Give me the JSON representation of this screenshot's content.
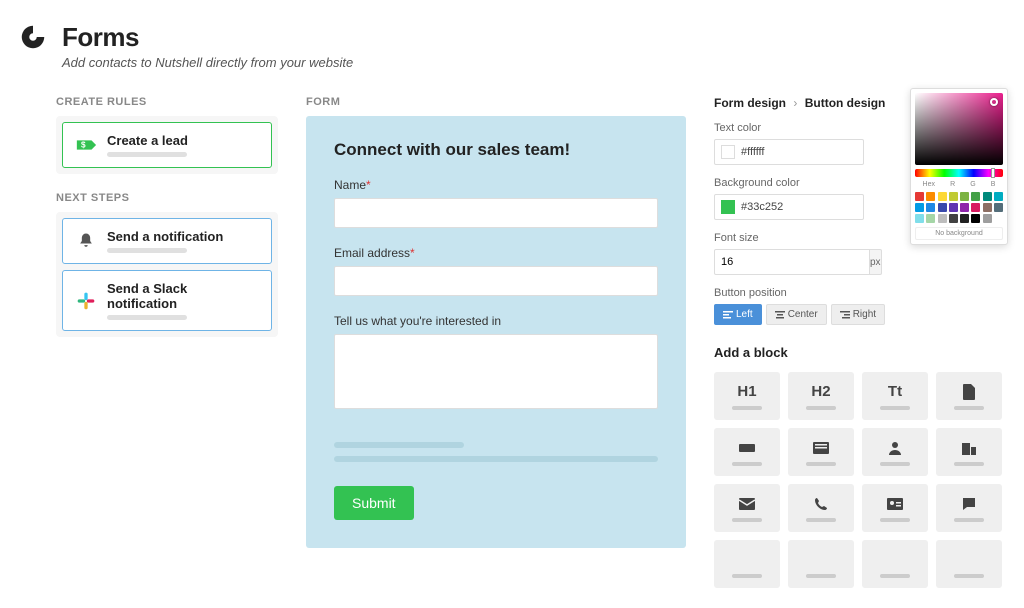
{
  "header": {
    "title": "Forms",
    "subtitle": "Add contacts to Nutshell directly from your website"
  },
  "left": {
    "create_rules_label": "CREATE RULES",
    "next_steps_label": "NEXT STEPS",
    "create_lead": "Create a lead",
    "send_notification": "Send a notification",
    "send_slack": "Send a Slack notification"
  },
  "mid": {
    "section_label": "FORM",
    "form_title": "Connect with our sales team!",
    "name_label": "Name",
    "email_label": "Email address",
    "interest_label": "Tell us what you're interested in",
    "submit": "Submit"
  },
  "right": {
    "breadcrumb1": "Form design",
    "breadcrumb2": "Button design",
    "text_color_label": "Text color",
    "text_color_value": "#ffffff",
    "bg_color_label": "Background color",
    "bg_color_value": "#33c252",
    "font_size_label": "Font size",
    "font_size_value": "16",
    "font_size_unit": "px",
    "button_position_label": "Button position",
    "pos_left": "Left",
    "pos_center": "Center",
    "pos_right": "Right",
    "add_block_label": "Add a block",
    "h1": "H1",
    "h2": "H2",
    "tt": "Tt",
    "cp_hex": "Hex",
    "cp_r": "R",
    "cp_g": "G",
    "cp_b": "B",
    "cp_nobg": "No background",
    "swatch_colors": [
      "#e53935",
      "#fb8c00",
      "#fdd835",
      "#c0ca33",
      "#7cb342",
      "#43a047",
      "#00897b",
      "#00acc1",
      "#039be5",
      "#1e88e5",
      "#3949ab",
      "#5e35b1",
      "#8e24aa",
      "#d81b60",
      "#8d6e63",
      "#546e7a",
      "#80deea",
      "#a5d6a7",
      "#bdbdbd",
      "#424242",
      "#212121",
      "#000000",
      "#9e9e9e",
      "#ffffff"
    ]
  }
}
